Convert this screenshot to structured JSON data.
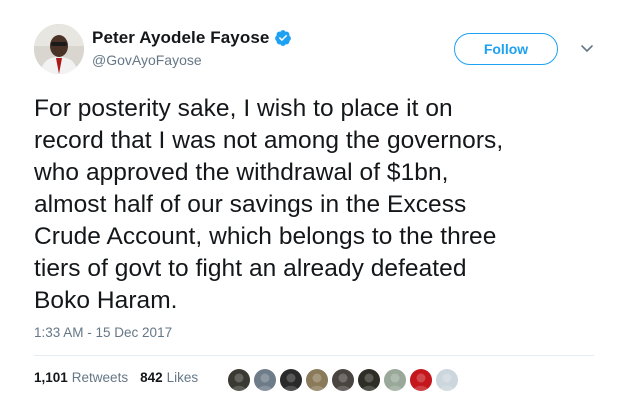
{
  "author": {
    "display_name": "Peter Ayodele Fayose",
    "handle": "@GovAyoFayose",
    "verified": true
  },
  "follow_label": "Follow",
  "tweet_text": "For posterity sake, I wish to place it on\nrecord that I was not among the governors,\nwho approved the withdrawal of $1bn,\nalmost half of our savings in the Excess\nCrude Account, which belongs to the three\ntiers of govt to fight an already defeated\nBoko Haram.",
  "timestamp": "1:33 AM - 15 Dec 2017",
  "stats": {
    "retweets_count": "1,101",
    "retweets_label": "Retweets",
    "likes_count": "842",
    "likes_label": "Likes"
  },
  "likers": [
    {
      "color": "#3a3a32"
    },
    {
      "color": "#6e7c8a"
    },
    {
      "color": "#2a2a2a"
    },
    {
      "color": "#8a7a5a"
    },
    {
      "color": "#4a4440"
    },
    {
      "color": "#2e2e26"
    },
    {
      "color": "#9aa89a"
    },
    {
      "color": "#c4161c"
    },
    {
      "color": "#ccd6dd"
    }
  ],
  "colors": {
    "accent": "#1da1f2",
    "text": "#14171a",
    "muted": "#657786",
    "divider": "#e6ecf0"
  },
  "icons": [
    "verified-badge-icon",
    "chevron-down-icon"
  ]
}
